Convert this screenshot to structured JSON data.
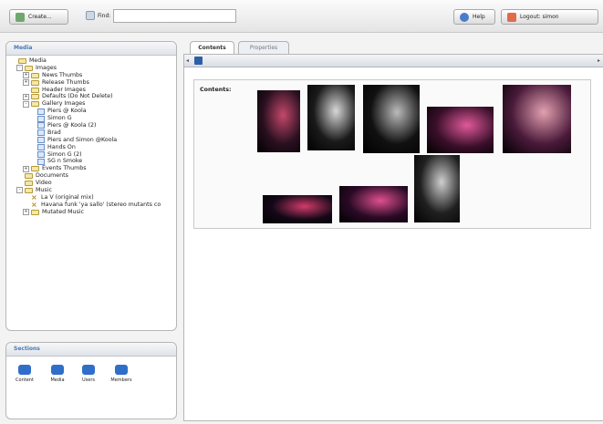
{
  "topbar": {
    "create_label": "Create...",
    "find_label": "Find:",
    "find_value": "",
    "help_label": "Help",
    "logout_label": "Logout: simon"
  },
  "media_panel": {
    "title": "Media",
    "tree": [
      {
        "label": "Media",
        "type": "folder",
        "depth": 0,
        "expander": "none"
      },
      {
        "label": "Images",
        "type": "folder",
        "depth": 1,
        "expander": "-"
      },
      {
        "label": "News Thumbs",
        "type": "folder",
        "depth": 2,
        "expander": "+"
      },
      {
        "label": "Release Thumbs",
        "type": "folder",
        "depth": 2,
        "expander": "+"
      },
      {
        "label": "Header Images",
        "type": "folder",
        "depth": 2,
        "expander": "none"
      },
      {
        "label": "Defaults (Do Not Delete)",
        "type": "folder",
        "depth": 2,
        "expander": "+"
      },
      {
        "label": "Gallery Images",
        "type": "folder",
        "depth": 2,
        "expander": "-"
      },
      {
        "label": "Piers @ Koola",
        "type": "image",
        "depth": 3,
        "expander": "none"
      },
      {
        "label": "Simon G",
        "type": "image",
        "depth": 3,
        "expander": "none"
      },
      {
        "label": "Piers @ Koola (2)",
        "type": "image",
        "depth": 3,
        "expander": "none"
      },
      {
        "label": "Brad",
        "type": "image",
        "depth": 3,
        "expander": "none"
      },
      {
        "label": "Piers and Simon @Koola",
        "type": "image",
        "depth": 3,
        "expander": "none"
      },
      {
        "label": "Hands On",
        "type": "image",
        "depth": 3,
        "expander": "none"
      },
      {
        "label": "Simon G (2)",
        "type": "image",
        "depth": 3,
        "expander": "none"
      },
      {
        "label": "SG n Smoke",
        "type": "image",
        "depth": 3,
        "expander": "none"
      },
      {
        "label": "Events Thumbs",
        "type": "folder",
        "depth": 2,
        "expander": "+"
      },
      {
        "label": "Documents",
        "type": "folder",
        "depth": 1,
        "expander": "none"
      },
      {
        "label": "Video",
        "type": "folder",
        "depth": 1,
        "expander": "none"
      },
      {
        "label": "Music",
        "type": "folder",
        "depth": 1,
        "expander": "-"
      },
      {
        "label": "La V (original mix)",
        "type": "music",
        "depth": 2,
        "expander": "none"
      },
      {
        "label": "Havana funk 'ya sallo' (stereo mutants co",
        "type": "music",
        "depth": 2,
        "expander": "none"
      },
      {
        "label": "Mutated Music",
        "type": "folder",
        "depth": 2,
        "expander": "+"
      }
    ]
  },
  "sections_panel": {
    "title": "Sections",
    "items": [
      {
        "label": "Content",
        "icon": "content-icon"
      },
      {
        "label": "Media",
        "icon": "media-icon"
      },
      {
        "label": "Users",
        "icon": "users-icon"
      },
      {
        "label": "Members",
        "icon": "members-icon"
      }
    ]
  },
  "tabs": [
    {
      "label": "Contents",
      "active": true
    },
    {
      "label": "Properties",
      "active": false
    }
  ],
  "main": {
    "contents_label": "Contents:",
    "save_icon": "save-icon"
  },
  "thumbnails": [
    {
      "name": "photo-1",
      "bg": "#2a1020",
      "accent": "#c4486a"
    },
    {
      "name": "photo-2",
      "bg": "#1a1a1a",
      "accent": "#d8d8d8"
    },
    {
      "name": "photo-3",
      "bg": "#111111",
      "accent": "#bbbbbb"
    },
    {
      "name": "photo-4",
      "bg": "#3a0f2a",
      "accent": "#e05a9a"
    },
    {
      "name": "photo-5",
      "bg": "#4a1a3a",
      "accent": "#e3a0b0"
    },
    {
      "name": "photo-6",
      "bg": "#140818",
      "accent": "#d23b6a"
    },
    {
      "name": "photo-7",
      "bg": "#2a0a26",
      "accent": "#e0508e"
    },
    {
      "name": "photo-8",
      "bg": "#202020",
      "accent": "#cfcfcf"
    }
  ]
}
